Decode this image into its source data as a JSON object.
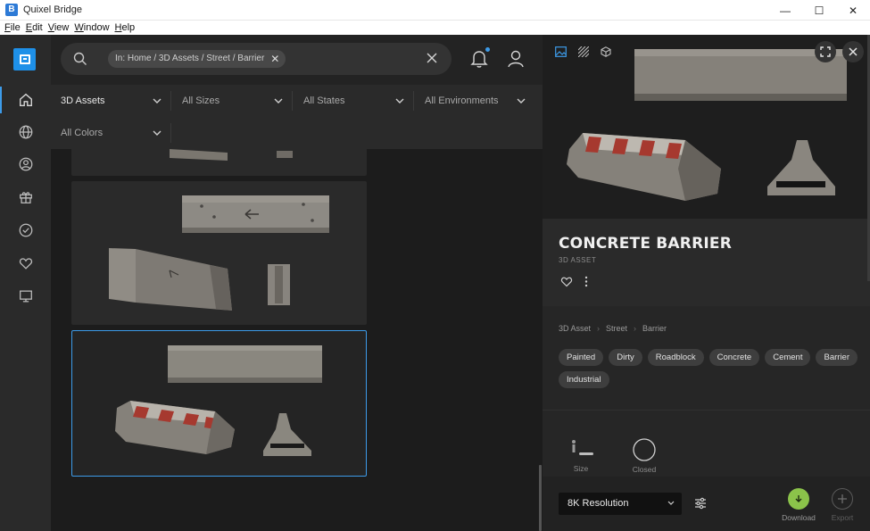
{
  "window": {
    "title": "Quixel Bridge",
    "icon_letter": "B",
    "controls": [
      "—",
      "☐",
      "✕"
    ]
  },
  "menu": [
    "File",
    "Edit",
    "View",
    "Window",
    "Help"
  ],
  "nav": {
    "items": [
      {
        "name": "home-icon",
        "active": true
      },
      {
        "name": "globe-icon",
        "active": false
      },
      {
        "name": "user-circle-icon",
        "active": false
      },
      {
        "name": "gift-icon",
        "active": false
      },
      {
        "name": "check-circle-icon",
        "active": false
      },
      {
        "name": "heart-icon",
        "active": false
      },
      {
        "name": "monitor-icon",
        "active": false
      }
    ]
  },
  "search": {
    "chip": "In: Home / 3D Assets / Street / Barrier",
    "chip_close": "✕"
  },
  "filters": [
    {
      "label": "3D Assets",
      "selected": true
    },
    {
      "label": "All Sizes",
      "selected": false
    },
    {
      "label": "All States",
      "selected": false
    },
    {
      "label": "All Environments",
      "selected": false
    },
    {
      "label": "All Colors",
      "selected": false
    }
  ],
  "detail": {
    "title": "CONCRETE BARRIER",
    "type": "3D ASSET",
    "breadcrumb": [
      "3D Asset",
      "Street",
      "Barrier"
    ],
    "tags": [
      "Painted",
      "Dirty",
      "Roadblock",
      "Concrete",
      "Cement",
      "Barrier",
      "Industrial"
    ],
    "meta": [
      {
        "label": "Size"
      },
      {
        "label": "Closed"
      }
    ],
    "resolution": "8K Resolution",
    "download_label": "Download",
    "export_label": "Export"
  },
  "colors": {
    "accent": "#3d9be9",
    "download": "#8bc34a"
  }
}
